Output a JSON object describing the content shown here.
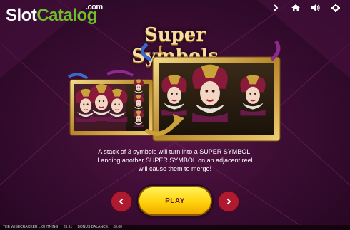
{
  "watermark": {
    "main_white": "Slot",
    "main_green": "Catalog",
    "suffix": ".com"
  },
  "topbar": {
    "items": [
      {
        "name": "chevron-right-icon"
      },
      {
        "name": "home-icon"
      },
      {
        "name": "sound-icon"
      },
      {
        "name": "settings-icon"
      }
    ]
  },
  "screen": {
    "title": "Super Symbols",
    "description": [
      "A stack of 3 symbols will turn into a SUPER SYMBOL.",
      "Landing another SUPER SYMBOL on an adjacent reel",
      "will cause them to merge!"
    ]
  },
  "controls": {
    "play_label": "PLAY",
    "prev_icon": "chevron-left-icon",
    "next_icon": "chevron-right-icon"
  },
  "footer": {
    "game": "THE WISECRACKER LIGHTNING",
    "time": "23:31",
    "balance_label": "BONUS BALANCE:",
    "balance": "£0.00"
  },
  "colors": {
    "accent": "#ffd20a",
    "nav": "#b01a30",
    "background": "#3c0d33",
    "gold": "#c9a23a"
  }
}
